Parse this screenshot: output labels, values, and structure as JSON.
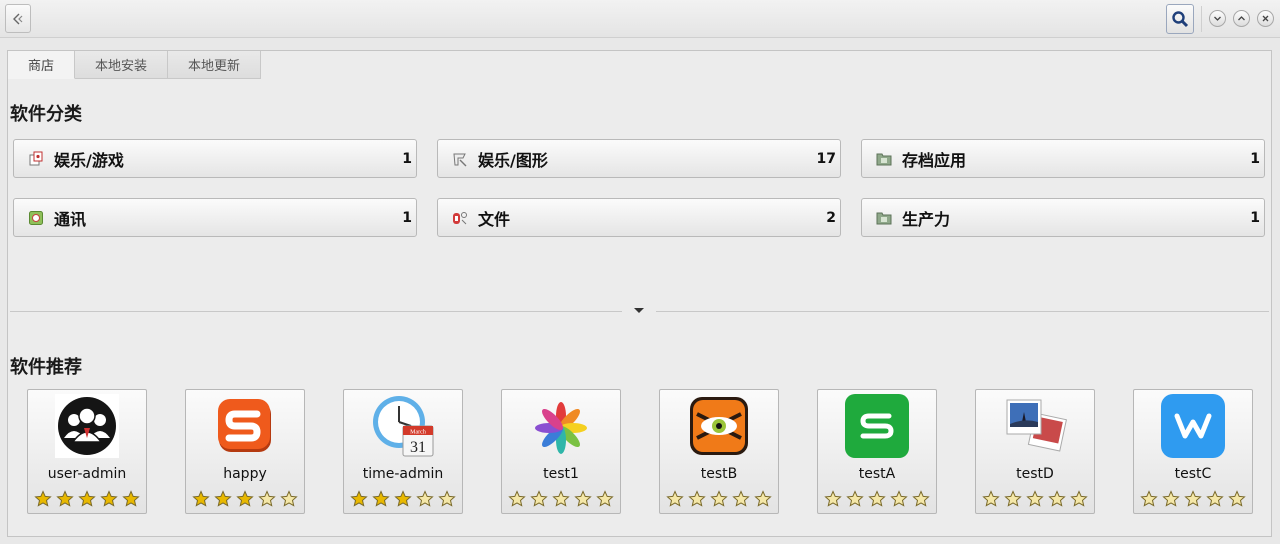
{
  "tabs": [
    {
      "label": "商店"
    },
    {
      "label": "本地安装"
    },
    {
      "label": "本地更新"
    }
  ],
  "categories_section": {
    "title": "软件分类",
    "items": [
      {
        "label": "娱乐/游戏",
        "count": "1",
        "icon": "game-icon"
      },
      {
        "label": "娱乐/图形",
        "count": "17",
        "icon": "graphics-icon"
      },
      {
        "label": "存档应用",
        "count": "1",
        "icon": "archive-folder-icon"
      },
      {
        "label": "通讯",
        "count": "1",
        "icon": "communication-icon"
      },
      {
        "label": "文件",
        "count": "2",
        "icon": "file-icon"
      },
      {
        "label": "生产力",
        "count": "1",
        "icon": "productivity-folder-icon"
      }
    ]
  },
  "recommend_section": {
    "title": "软件推荐",
    "apps": [
      {
        "name": "user-admin",
        "rating": 5,
        "icon": "users-group-icon"
      },
      {
        "name": "happy",
        "rating": 3,
        "icon": "sogou-s-icon"
      },
      {
        "name": "time-admin",
        "rating": 3,
        "icon": "clock-calendar-icon"
      },
      {
        "name": "test1",
        "rating": 0,
        "icon": "flower-pinwheel-icon"
      },
      {
        "name": "testB",
        "rating": 0,
        "icon": "tiger-eye-icon"
      },
      {
        "name": "testA",
        "rating": 0,
        "icon": "green-s-icon"
      },
      {
        "name": "testD",
        "rating": 0,
        "icon": "photos-icon"
      },
      {
        "name": "testC",
        "rating": 0,
        "icon": "blue-w-icon"
      }
    ]
  },
  "colors": {
    "star_filled": "#e8b800",
    "star_empty": "#f4e7a8",
    "green_app": "#1faa3d",
    "blue_app": "#2f9bf0"
  }
}
